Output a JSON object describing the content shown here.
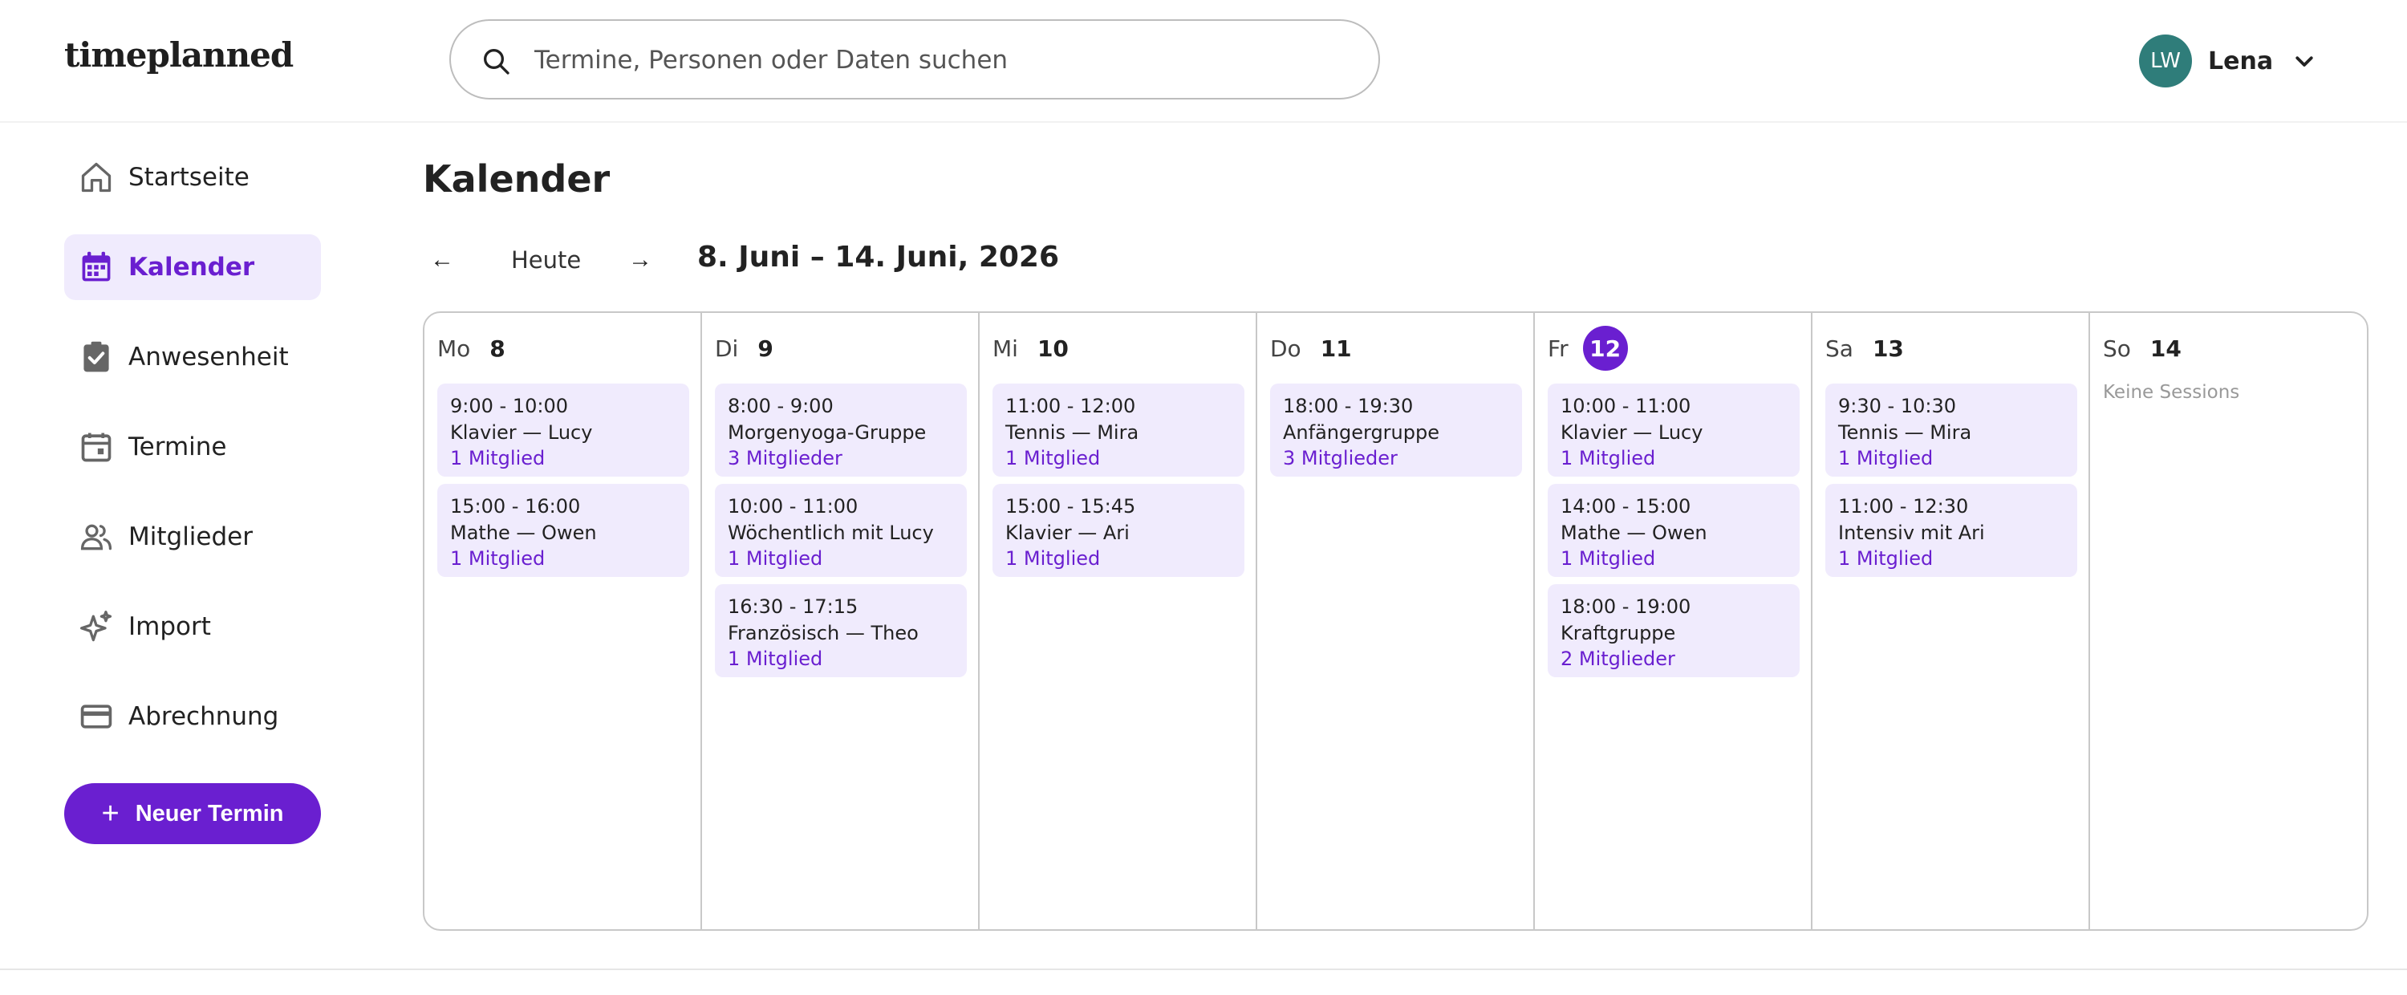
{
  "app": {
    "logo": "timeplanned"
  },
  "search": {
    "placeholder": "Termine, Personen oder Daten suchen",
    "icon": "search-icon"
  },
  "user": {
    "initials": "LW",
    "name": "Lena",
    "avatar_color": "#2f7d7a"
  },
  "colors": {
    "accent": "#6a1fd0",
    "event_bg": "#f0ebfd",
    "active_nav_bg": "#f0ebfd"
  },
  "sidebar": {
    "items": [
      {
        "label": "Startseite",
        "icon": "home-icon",
        "active": false
      },
      {
        "label": "Kalender",
        "icon": "calendar-icon",
        "active": true
      },
      {
        "label": "Anwesenheit",
        "icon": "clipboard-check-icon",
        "active": false
      },
      {
        "label": "Termine",
        "icon": "calendar-event-icon",
        "active": false
      },
      {
        "label": "Mitglieder",
        "icon": "users-icon",
        "active": false
      },
      {
        "label": "Import",
        "icon": "sparkle-icon",
        "active": false
      },
      {
        "label": "Abrechnung",
        "icon": "credit-card-icon",
        "active": false
      }
    ],
    "new_button": {
      "label": "Neuer Termin",
      "icon": "plus-icon"
    }
  },
  "main": {
    "title": "Kalender",
    "nav": {
      "prev": "←",
      "today": "Heute",
      "next": "→",
      "range": "8. Juni – 14. Juni, 2026"
    },
    "days": [
      {
        "abbr": "Mo",
        "num": "8",
        "today": false,
        "events": [
          {
            "time": "9:00 - 10:00",
            "title": "Klavier — Lucy",
            "members": "1 Mitglied"
          },
          {
            "time": "15:00 - 16:00",
            "title": "Mathe — Owen",
            "members": "1 Mitglied"
          }
        ]
      },
      {
        "abbr": "Di",
        "num": "9",
        "today": false,
        "events": [
          {
            "time": "8:00 - 9:00",
            "title": "Morgenyoga-Gruppe",
            "members": "3 Mitglieder"
          },
          {
            "time": "10:00 - 11:00",
            "title": "Wöchentlich mit Lucy",
            "members": "1 Mitglied"
          },
          {
            "time": "16:30 - 17:15",
            "title": "Französisch — Theo",
            "members": "1 Mitglied"
          }
        ]
      },
      {
        "abbr": "Mi",
        "num": "10",
        "today": false,
        "events": [
          {
            "time": "11:00 - 12:00",
            "title": "Tennis — Mira",
            "members": "1 Mitglied"
          },
          {
            "time": "15:00 - 15:45",
            "title": "Klavier — Ari",
            "members": "1 Mitglied"
          }
        ]
      },
      {
        "abbr": "Do",
        "num": "11",
        "today": false,
        "events": [
          {
            "time": "18:00 - 19:30",
            "title": "Anfängergruppe",
            "members": "3 Mitglieder"
          }
        ]
      },
      {
        "abbr": "Fr",
        "num": "12",
        "today": true,
        "events": [
          {
            "time": "10:00 - 11:00",
            "title": "Klavier — Lucy",
            "members": "1 Mitglied"
          },
          {
            "time": "14:00 - 15:00",
            "title": "Mathe — Owen",
            "members": "1 Mitglied"
          },
          {
            "time": "18:00 - 19:00",
            "title": "Kraftgruppe",
            "members": "2 Mitglieder"
          }
        ]
      },
      {
        "abbr": "Sa",
        "num": "13",
        "today": false,
        "events": [
          {
            "time": "9:30 - 10:30",
            "title": "Tennis — Mira",
            "members": "1 Mitglied"
          },
          {
            "time": "11:00 - 12:30",
            "title": "Intensiv mit Ari",
            "members": "1 Mitglied"
          }
        ]
      },
      {
        "abbr": "So",
        "num": "14",
        "today": false,
        "empty_note": "Keine Sessions",
        "events": []
      }
    ]
  }
}
